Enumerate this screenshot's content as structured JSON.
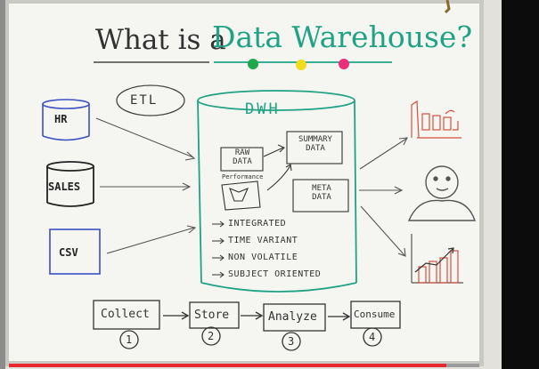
{
  "title": {
    "prefix": "What is a",
    "highlight": "Data Warehouse",
    "suffix": "?"
  },
  "etl_label": "ETL",
  "dwh_label": "DWH",
  "sources": [
    "HR",
    "SALES",
    "CSV"
  ],
  "inner_boxes": {
    "raw": "RAW\nDATA",
    "summary": "SUMMARY\nDATA",
    "meta": "META\nDATA",
    "performance": "Performance"
  },
  "features": [
    "INTEGRATED",
    "TIME VARIANT",
    "NON VOLATILE",
    "SUBJECT ORIENTED"
  ],
  "steps": [
    {
      "label": "Collect",
      "num": "1"
    },
    {
      "label": "Store",
      "num": "2"
    },
    {
      "label": "Analyze",
      "num": "3"
    },
    {
      "label": "Consume",
      "num": "4"
    }
  ],
  "colors": {
    "board": "#f4f4f1",
    "marker_green": "#1fa384",
    "dot_green": "#1fa84a",
    "dot_yellow": "#f1dc1c",
    "dot_pink": "#e8317a",
    "marker_red": "#d4503c",
    "marker_blue": "#3b4fc4",
    "progress": "#e8292f"
  },
  "video_progress": 0.93
}
